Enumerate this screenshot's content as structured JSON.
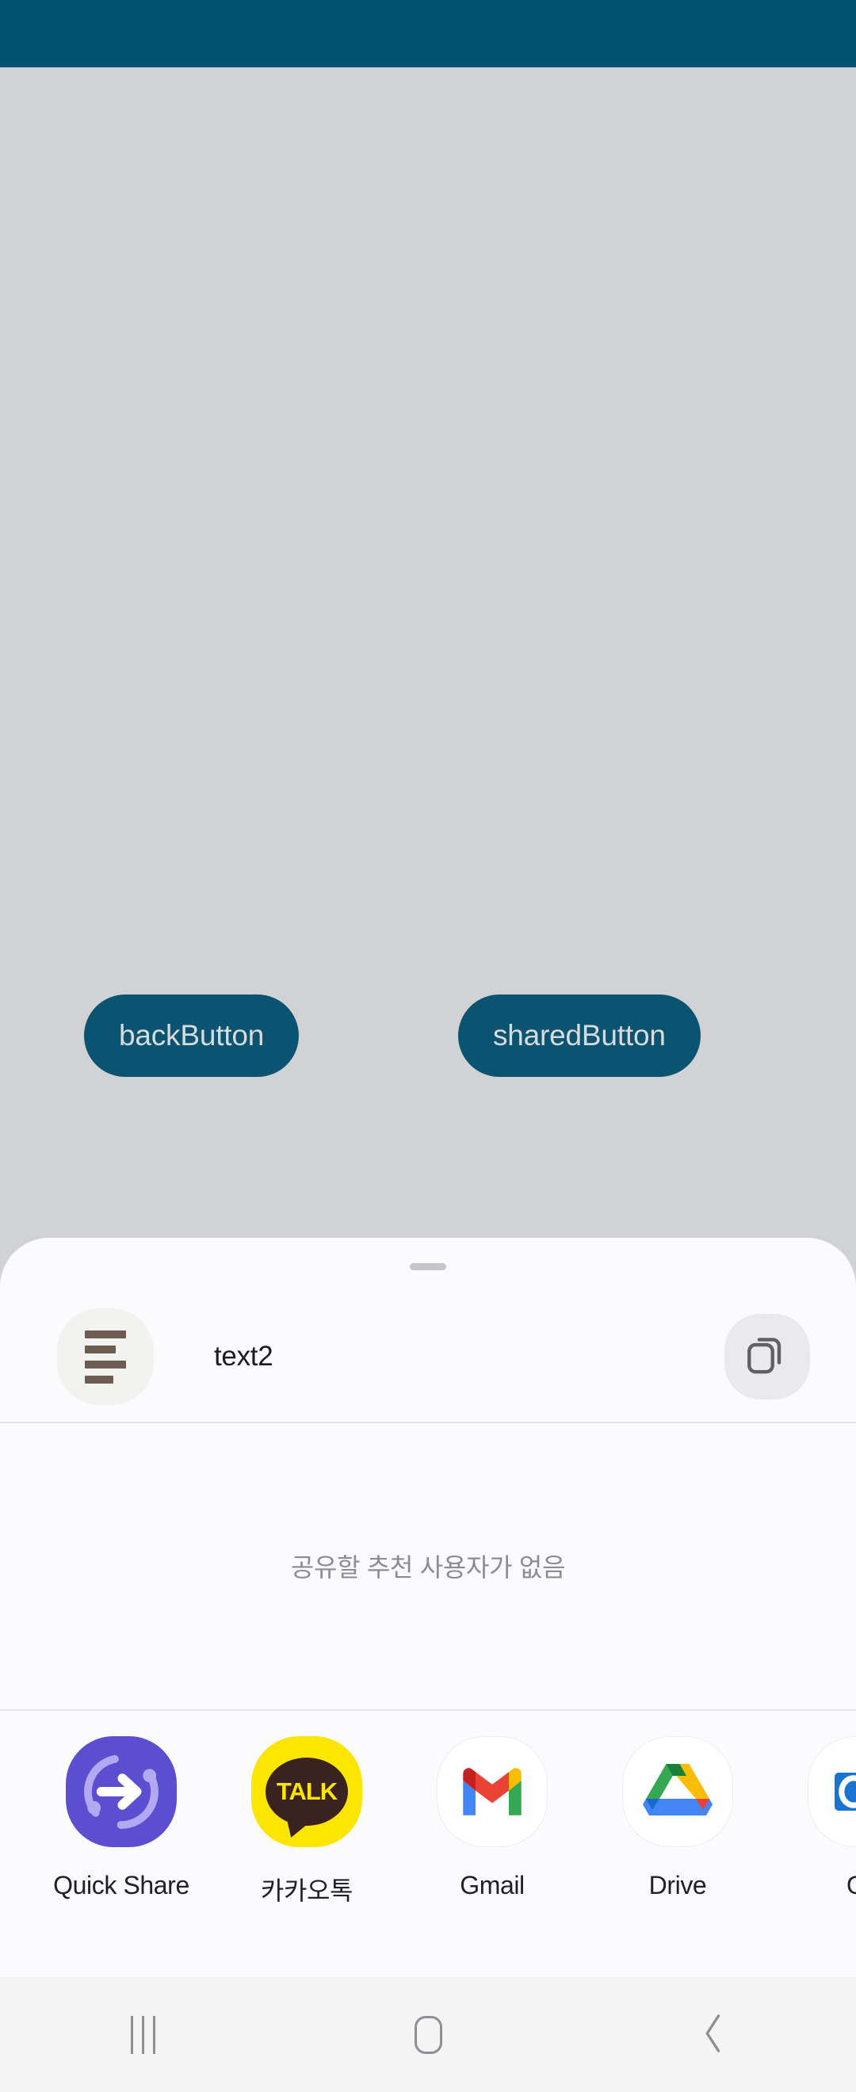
{
  "colors": {
    "status_bar": "#005272",
    "app_background": "#d1d2d4",
    "button_fill": "#0a5472",
    "button_text": "#d8dadb",
    "sheet_background": "#fbfbfd",
    "nav_background": "#f4f4f5",
    "divider": "#e3e4e7",
    "empty_text": "#8b8d93"
  },
  "status_bar": {
    "name": "status-bar"
  },
  "app_screen": {
    "buttons": [
      {
        "label": "backButton",
        "name": "back-button"
      },
      {
        "label": "sharedButton",
        "name": "shared-button"
      }
    ]
  },
  "share_sheet": {
    "drag_handle": "drag-handle",
    "preview": {
      "icon": "text-lines-icon",
      "title": "text2",
      "copy_icon": "copy-icon"
    },
    "empty_state": "공유할 추천 사용자가 없음",
    "apps": [
      {
        "label": "Quick Share",
        "icon": "quick-share-icon"
      },
      {
        "label": "카카오톡",
        "icon": "kakaotalk-icon",
        "badge_text": "TALK"
      },
      {
        "label": "Gmail",
        "icon": "gmail-icon"
      },
      {
        "label": "Drive",
        "icon": "google-drive-icon"
      },
      {
        "label": "Ou",
        "icon": "outlook-icon"
      }
    ]
  },
  "navigation_bar": {
    "buttons": [
      {
        "name": "recents-button",
        "icon": "recents-icon"
      },
      {
        "name": "home-button",
        "icon": "home-icon"
      },
      {
        "name": "back-nav-button",
        "icon": "chevron-left-icon"
      }
    ]
  }
}
